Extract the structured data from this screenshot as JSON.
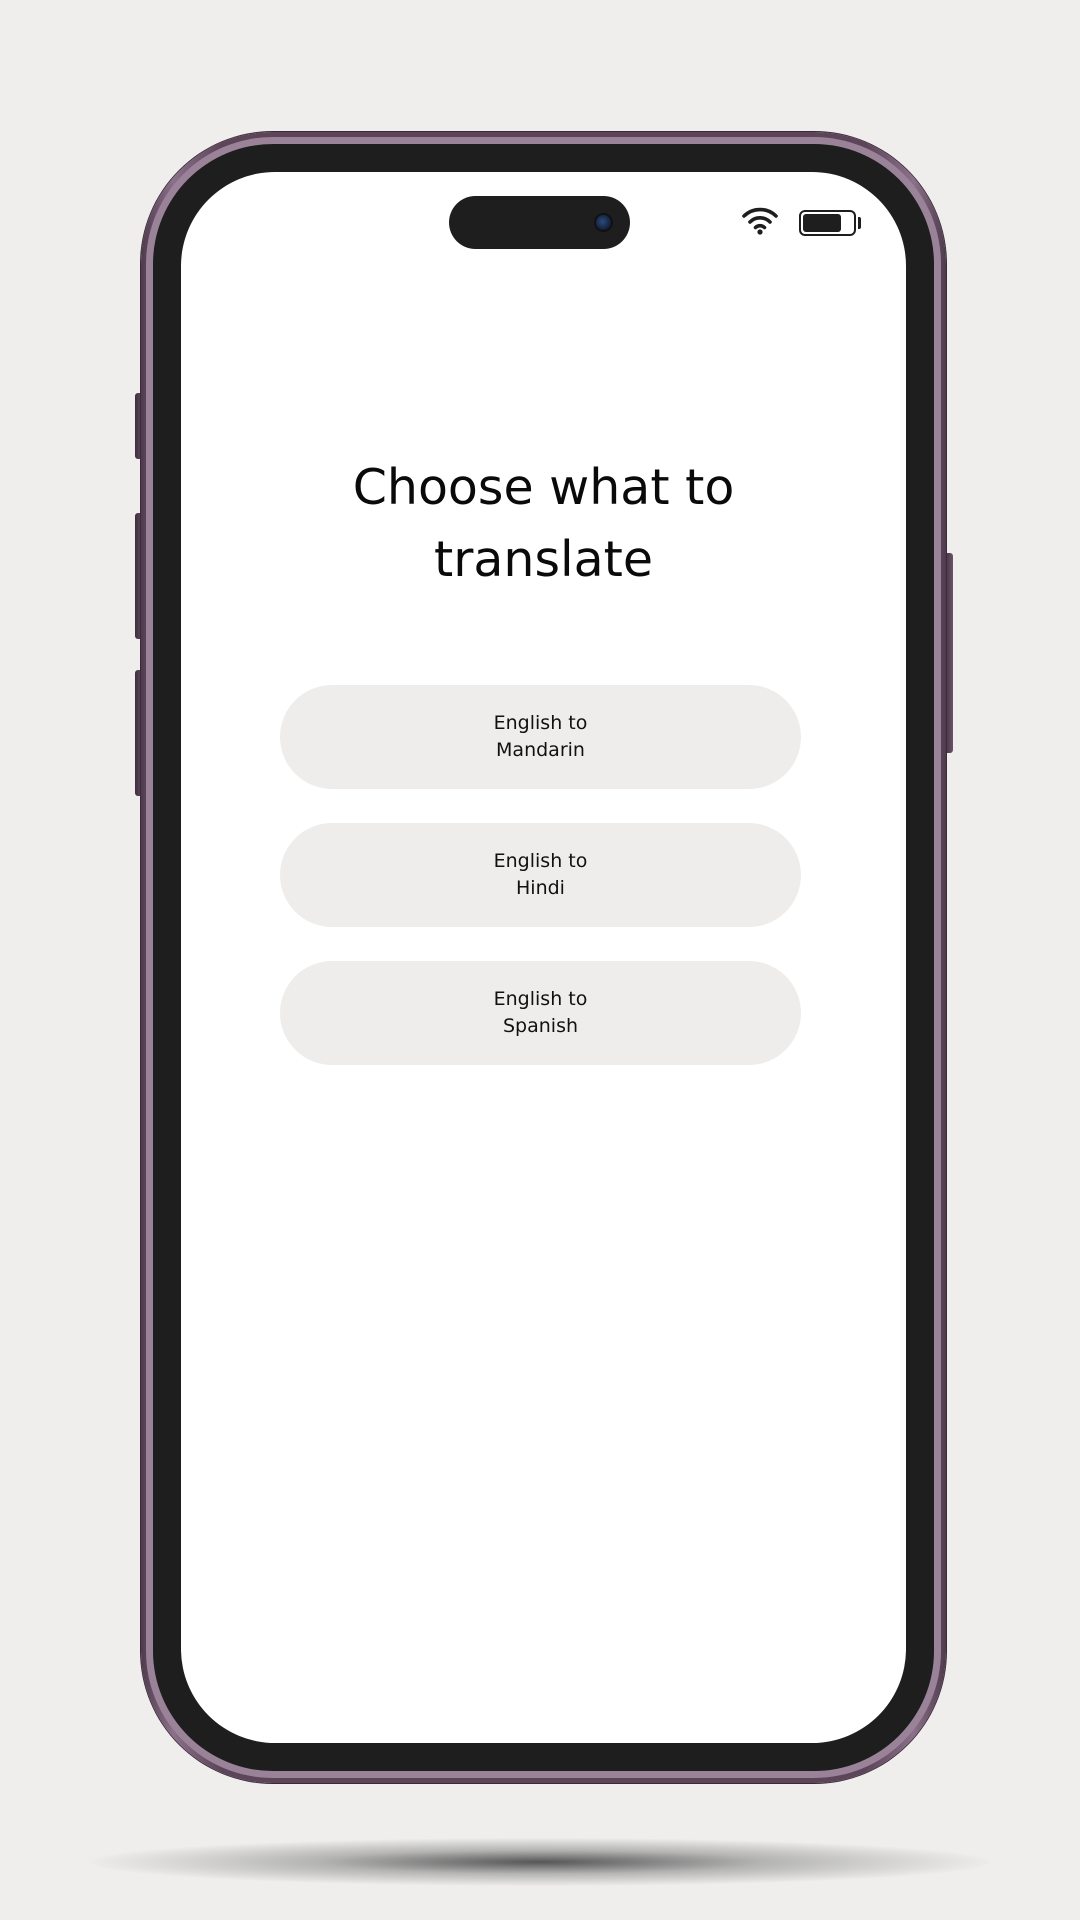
{
  "screen": {
    "title_lines": [
      "Choose what to",
      "translate"
    ]
  },
  "status_bar": {
    "wifi_icon": "wifi-icon",
    "battery_icon": "battery-icon",
    "battery_level": 0.78
  },
  "options": [
    {
      "line1": "English to",
      "line2": "Mandarin"
    },
    {
      "line1": "English to",
      "line2": "Hindi"
    },
    {
      "line1": "English to",
      "line2": "Spanish"
    }
  ],
  "colors": {
    "background": "#efeeed",
    "phone_frame": "#5c4459",
    "bezel": "#1e1e1e",
    "screen": "#ffffff",
    "button": "#eeedeb",
    "text": "#0a0a0a"
  }
}
